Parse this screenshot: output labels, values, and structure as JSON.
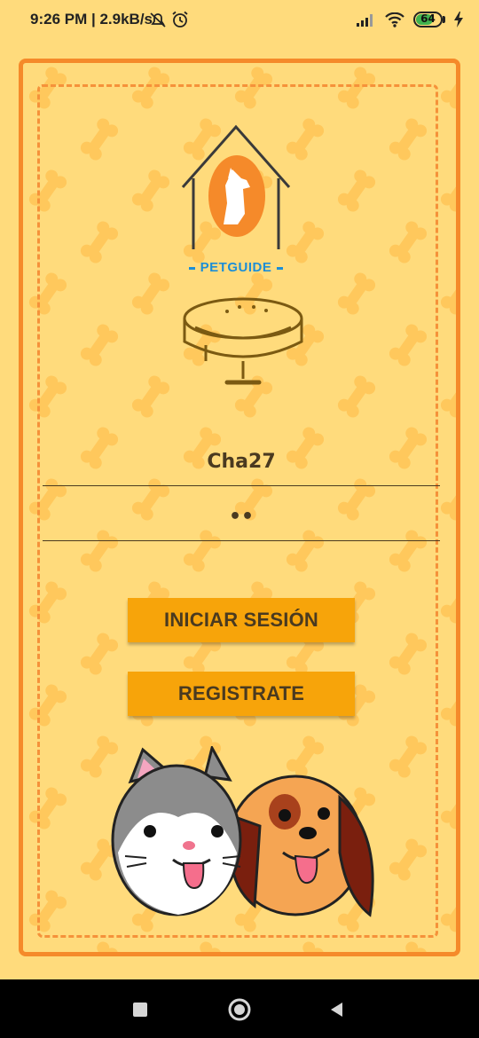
{
  "status_bar": {
    "time_text": "9:26 PM | 2.9kB/s",
    "battery": "64",
    "icons": [
      "alarm-off-icon",
      "alarm-icon",
      "signal-icon",
      "wifi-icon",
      "battery-icon",
      "charging-icon"
    ]
  },
  "logo": {
    "brand_text": "PETGUIDE"
  },
  "login_form": {
    "username_value": "Cha27",
    "password_value": "••",
    "login_button_label": "INICIAR SESIÓN",
    "register_button_label": "REGISTRATE"
  },
  "nav_bar": {
    "icons": [
      "recent-apps-icon",
      "home-icon",
      "back-icon"
    ]
  },
  "colors": {
    "background": "#ffdb7c",
    "frame": "#f58a2a",
    "button": "#f7a40a",
    "text": "#4a3a20"
  }
}
